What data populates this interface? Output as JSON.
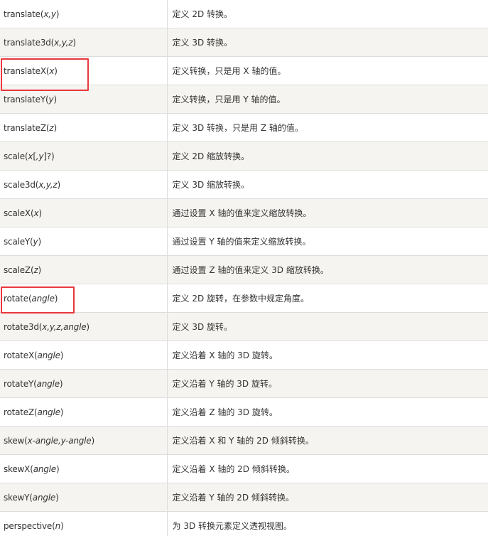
{
  "table": {
    "rows": [
      {
        "fn": [
          {
            "t": "translate("
          },
          {
            "t": "x,y",
            "i": true
          },
          {
            "t": ")"
          }
        ],
        "desc": "定义 2D 转换。"
      },
      {
        "fn": [
          {
            "t": "translate3d("
          },
          {
            "t": "x,y,z",
            "i": true
          },
          {
            "t": ")"
          }
        ],
        "desc": "定义 3D 转换。"
      },
      {
        "fn": [
          {
            "t": "translateX("
          },
          {
            "t": "x",
            "i": true
          },
          {
            "t": ")"
          }
        ],
        "desc": "定义转换，只是用 X 轴的值。"
      },
      {
        "fn": [
          {
            "t": "translateY("
          },
          {
            "t": "y",
            "i": true
          },
          {
            "t": ")"
          }
        ],
        "desc": "定义转换，只是用 Y 轴的值。"
      },
      {
        "fn": [
          {
            "t": "translateZ("
          },
          {
            "t": "z",
            "i": true
          },
          {
            "t": ")"
          }
        ],
        "desc": "定义 3D 转换，只是用 Z 轴的值。"
      },
      {
        "fn": [
          {
            "t": "scale("
          },
          {
            "t": "x",
            "i": true
          },
          {
            "t": "["
          },
          {
            "t": ",y",
            "i": true
          },
          {
            "t": "]?)"
          }
        ],
        "desc": "定义 2D 缩放转换。"
      },
      {
        "fn": [
          {
            "t": "scale3d("
          },
          {
            "t": "x,y,z",
            "i": true
          },
          {
            "t": ")"
          }
        ],
        "desc": "定义 3D 缩放转换。"
      },
      {
        "fn": [
          {
            "t": "scaleX("
          },
          {
            "t": "x",
            "i": true
          },
          {
            "t": ")"
          }
        ],
        "desc": "通过设置 X 轴的值来定义缩放转换。"
      },
      {
        "fn": [
          {
            "t": "scaleY("
          },
          {
            "t": "y",
            "i": true
          },
          {
            "t": ")"
          }
        ],
        "desc": "通过设置 Y 轴的值来定义缩放转换。"
      },
      {
        "fn": [
          {
            "t": "scaleZ("
          },
          {
            "t": "z",
            "i": true
          },
          {
            "t": ")"
          }
        ],
        "desc": "通过设置 Z 轴的值来定义 3D 缩放转换。"
      },
      {
        "fn": [
          {
            "t": "rotate("
          },
          {
            "t": "angle",
            "i": true
          },
          {
            "t": ")"
          }
        ],
        "desc": "定义 2D 旋转，在参数中规定角度。"
      },
      {
        "fn": [
          {
            "t": "rotate3d("
          },
          {
            "t": "x,y,z,angle",
            "i": true
          },
          {
            "t": ")"
          }
        ],
        "desc": "定义 3D 旋转。"
      },
      {
        "fn": [
          {
            "t": "rotateX("
          },
          {
            "t": "angle",
            "i": true
          },
          {
            "t": ")"
          }
        ],
        "desc": "定义沿着 X 轴的 3D 旋转。"
      },
      {
        "fn": [
          {
            "t": "rotateY("
          },
          {
            "t": "angle",
            "i": true
          },
          {
            "t": ")"
          }
        ],
        "desc": "定义沿着 Y 轴的 3D 旋转。"
      },
      {
        "fn": [
          {
            "t": "rotateZ("
          },
          {
            "t": "angle",
            "i": true
          },
          {
            "t": ")"
          }
        ],
        "desc": "定义沿着 Z 轴的 3D 旋转。"
      },
      {
        "fn": [
          {
            "t": "skew("
          },
          {
            "t": "x-angle,y-angle",
            "i": true
          },
          {
            "t": ")"
          }
        ],
        "desc": "定义沿着 X 和 Y 轴的 2D 倾斜转换。"
      },
      {
        "fn": [
          {
            "t": "skewX("
          },
          {
            "t": "angle",
            "i": true
          },
          {
            "t": ")"
          }
        ],
        "desc": "定义沿着 X 轴的 2D 倾斜转换。"
      },
      {
        "fn": [
          {
            "t": "skewY("
          },
          {
            "t": "angle",
            "i": true
          },
          {
            "t": ")"
          }
        ],
        "desc": "定义沿着 Y 轴的 2D 倾斜转换。"
      },
      {
        "fn": [
          {
            "t": "perspective("
          },
          {
            "t": "n",
            "i": true
          },
          {
            "t": ")"
          }
        ],
        "desc": "为 3D 转换元素定义透视视图。"
      }
    ]
  },
  "highlights": {
    "color": "#e8383d",
    "rows": [
      "translateX(x)",
      "rotate(angle)"
    ]
  }
}
